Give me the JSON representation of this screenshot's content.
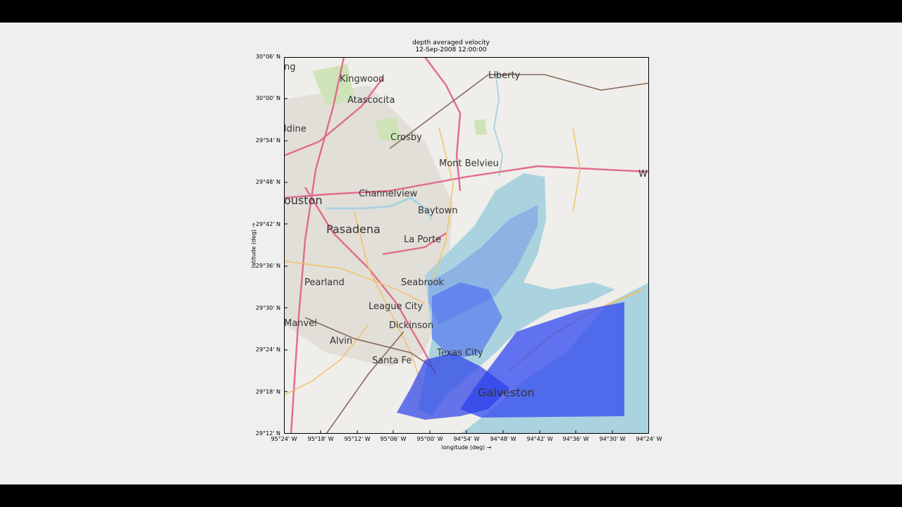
{
  "figure": {
    "title_line1": "depth averaged velocity",
    "title_line2": "12-Sep-2008 12:00:00",
    "xlabel": "longitude (deg) →",
    "ylabel": "latitude (deg) →",
    "xticks": [
      "95°24' W",
      "95°18' W",
      "95°12' W",
      "95°06' W",
      "95°00' W",
      "94°54' W",
      "94°48' W",
      "94°42' W",
      "94°36' W",
      "94°30' W",
      "94°24' W"
    ],
    "yticks": [
      "30°06' N",
      "30°00' N",
      "29°54' N",
      "29°48' N",
      "29°42' N",
      "29°36' N",
      "29°30' N",
      "29°24' N",
      "29°18' N",
      "29°12' N"
    ]
  },
  "map": {
    "place_labels": [
      "Kingwood",
      "Atascocita",
      "Liberty",
      "ldine",
      "Crosby",
      "Mont Belvieu",
      "W",
      "Channelview",
      "ouston",
      "Baytown",
      "Pasadena",
      "La Porte",
      "Pearland",
      "Seabrook",
      "League City",
      "Manvel",
      "Dickinson",
      "Alvin",
      "Texas City",
      "Santa Fe",
      "Galveston",
      "ng"
    ],
    "colors": {
      "land": "#f0eeea",
      "water": "#aad3df",
      "urban": "#e0ddd6",
      "highway": "#e06b8a",
      "road": "#f0c060",
      "rail": "#8a6a5a",
      "velocity_vectors": "#1a2fe0"
    }
  }
}
